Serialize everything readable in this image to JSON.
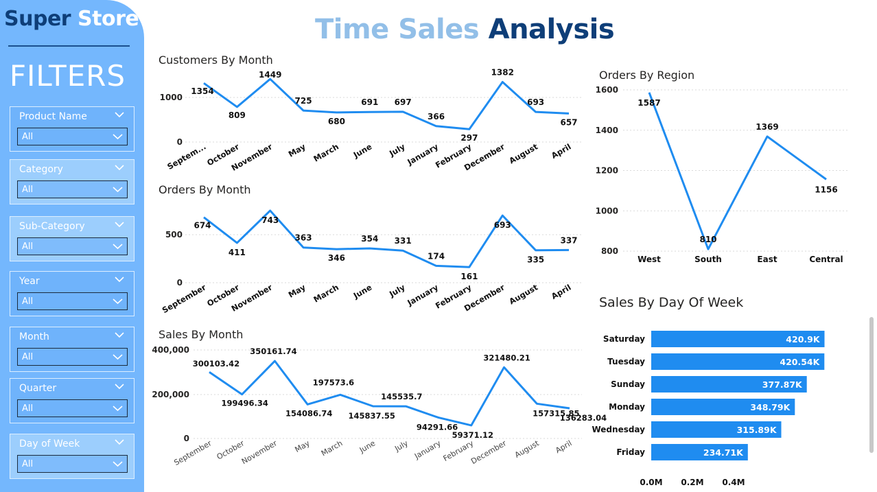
{
  "brand": {
    "part1": "Super",
    "part2": "Store"
  },
  "filters_title": "FILTERS",
  "page_title": {
    "part1": "Time Sales",
    "part2": "Analysis"
  },
  "slicers": [
    {
      "label": "Product Name",
      "value": "All"
    },
    {
      "label": "Category",
      "value": "All"
    },
    {
      "label": "Sub-Category",
      "value": "All"
    },
    {
      "label": "Year",
      "value": "All"
    },
    {
      "label": "Month",
      "value": "All"
    },
    {
      "label": "Quarter",
      "value": "All"
    },
    {
      "label": "Day of Week",
      "value": "All"
    }
  ],
  "colors": {
    "series": "#1f8cf0",
    "sidebar": "#74b7fd",
    "brand_dark": "#0e3e78",
    "title_light": "#92bfe8",
    "grid": "#d9d9d9"
  },
  "chart_data": [
    {
      "id": "customers",
      "type": "line",
      "title": "Customers By Month",
      "categories": [
        "Septem...",
        "October",
        "November",
        "May",
        "March",
        "June",
        "July",
        "January",
        "February",
        "December",
        "August",
        "April"
      ],
      "values": [
        1354,
        809,
        1449,
        725,
        680,
        691,
        697,
        366,
        297,
        1382,
        693,
        657
      ],
      "data_labels": [
        "1354",
        "809",
        "1449",
        "725",
        "680",
        "691",
        "697",
        "366",
        "297",
        "1382",
        "693",
        "657"
      ],
      "yticks": [
        "1000",
        "0"
      ],
      "ylim": [
        0,
        1500
      ],
      "grid": true
    },
    {
      "id": "orders",
      "type": "line",
      "title": "Orders By Month",
      "categories": [
        "September",
        "October",
        "November",
        "May",
        "March",
        "June",
        "July",
        "January",
        "February",
        "December",
        "August",
        "April"
      ],
      "values": [
        674,
        411,
        743,
        363,
        346,
        354,
        331,
        174,
        161,
        693,
        335,
        337
      ],
      "data_labels": [
        "674",
        "411",
        "743",
        "363",
        "346",
        "354",
        "331",
        "174",
        "161",
        "693",
        "335",
        "337"
      ],
      "yticks": [
        "500",
        "0"
      ],
      "ylim": [
        0,
        750
      ],
      "grid": true
    },
    {
      "id": "sales",
      "type": "line",
      "title": "Sales By Month",
      "categories": [
        "September",
        "October",
        "November",
        "May",
        "March",
        "June",
        "July",
        "January",
        "February",
        "December",
        "August",
        "April"
      ],
      "values": [
        300103.42,
        199496.34,
        350161.74,
        154086.74,
        197573.6,
        145837.55,
        145535.7,
        94291.66,
        59371.12,
        321480.21,
        157315.85,
        136283.04
      ],
      "data_labels": [
        "300103.42",
        "199496.34",
        "350161.74",
        "154086.74",
        "197573.6",
        "145837.55",
        "145535.7",
        "94291.66",
        "59371.12",
        "321480.21",
        "157315.85",
        "136283.04"
      ],
      "yticks": [
        "400,000",
        "200,000",
        "0"
      ],
      "ylim": [
        0,
        400000
      ],
      "grid": true
    },
    {
      "id": "region",
      "type": "line",
      "title": "Orders By Region",
      "categories": [
        "West",
        "South",
        "East",
        "Central"
      ],
      "values": [
        1587,
        810,
        1369,
        1156
      ],
      "data_labels": [
        "1587",
        "810",
        "1369",
        "1156"
      ],
      "yticks": [
        "1600",
        "1400",
        "1200",
        "1000",
        "800"
      ],
      "ylim": [
        800,
        1600
      ],
      "grid": true
    },
    {
      "id": "weekday",
      "type": "bar",
      "orientation": "horizontal",
      "title": "Sales By  Day Of Week",
      "categories": [
        "Saturday",
        "Tuesday",
        "Sunday",
        "Monday",
        "Wednesday",
        "Friday"
      ],
      "values": [
        420900,
        420540,
        377870,
        348790,
        315890,
        234710
      ],
      "data_labels": [
        "420.9K",
        "420.54K",
        "377.87K",
        "348.79K",
        "315.89K",
        "234.71K"
      ],
      "xticks": [
        "0.0M",
        "0.2M",
        "0.4M"
      ],
      "xlim": [
        0,
        500000
      ]
    }
  ]
}
